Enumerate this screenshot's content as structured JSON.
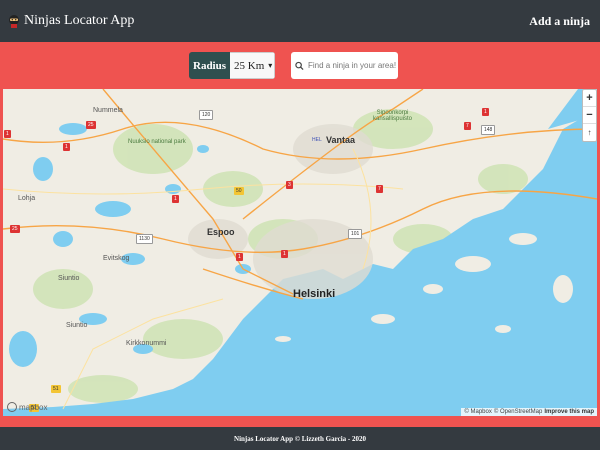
{
  "navbar": {
    "brand": "Ninjas Locator App",
    "add_link": "Add a ninja"
  },
  "controls": {
    "radius_label": "Radius",
    "radius_value": "25 Km",
    "search_placeholder": "Find a ninja in your area!"
  },
  "map": {
    "places": {
      "nummela": "Nummela",
      "nuuksio": "Nuuksio national park",
      "vantaa": "Vantaa",
      "hel": "HEL",
      "sipoonkorpi_line1": "Sipoonkorpi",
      "sipoonkorpi_line2": "kansallispuisto",
      "lohja": "Lohja",
      "espoo": "Espoo",
      "evitskog": "Evitskog",
      "siuntio1": "Siuntio",
      "siuntio2": "Siuntio",
      "kirkkonummi": "Kirkkonummi",
      "helsinki": "Helsinki"
    },
    "shields": {
      "s120": "120",
      "s25a": "25",
      "s1a": "1",
      "s7a": "7",
      "s148": "148",
      "s1b": "1",
      "s1c": "1",
      "s3": "3",
      "s7b": "7",
      "s50": "50",
      "s1d": "1",
      "s25b": "25",
      "s1130": "1130",
      "s101": "101",
      "s1e": "1",
      "s1f": "1",
      "s51": "51",
      "s51b": "51"
    },
    "zoom_in": "+",
    "zoom_out": "−",
    "compass": "↑",
    "attribution": {
      "mapbox": "© Mapbox",
      "osm": "© OpenStreetMap",
      "improve": "Improve this map"
    },
    "logo": "mapbox"
  },
  "footer": {
    "text": "Ninjas Locator App © Lizzeth Garcia - 2020"
  }
}
